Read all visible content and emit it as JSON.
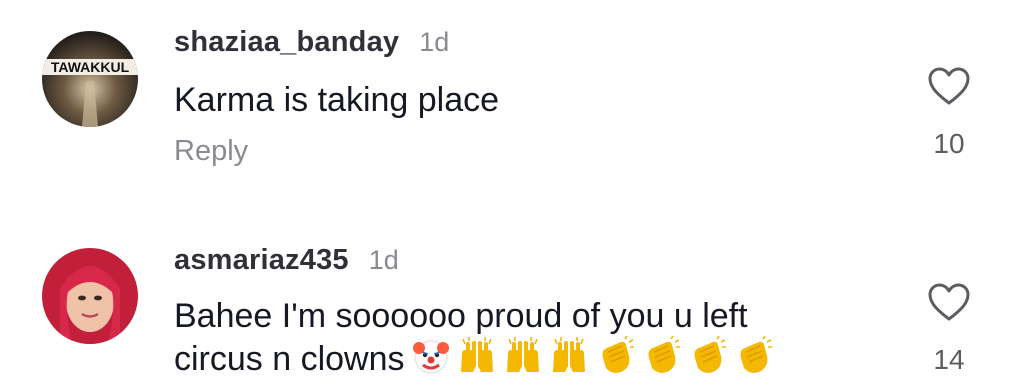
{
  "comments": [
    {
      "username": "shaziaa_banday",
      "time": "1d",
      "text": "Karma is taking place",
      "reply_label": "Reply",
      "like_count": "10",
      "avatar_text": "TAWAKKUL"
    },
    {
      "username": "asmariaz435",
      "time": "1d",
      "text_line1": "Bahee I'm soooooo proud of you u left",
      "text_line2": "circus n clowns",
      "like_count": "14",
      "emojis": [
        "clown-face",
        "raising-hands",
        "raising-hands",
        "raising-hands",
        "clapping-hands",
        "clapping-hands",
        "clapping-hands",
        "clapping-hands"
      ]
    }
  ]
}
